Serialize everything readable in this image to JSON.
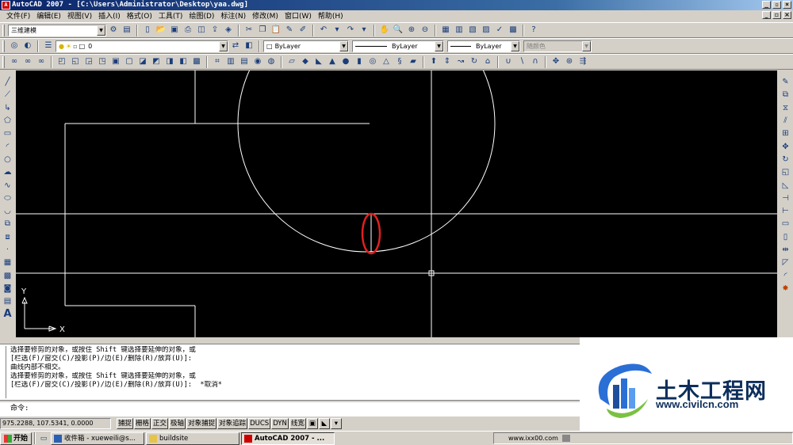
{
  "window": {
    "title": "AutoCAD 2007 - [C:\\Users\\Administrator\\Desktop\\yaa.dwg]",
    "app_icon_label": "A"
  },
  "menubar": {
    "items": [
      "文件(F)",
      "编辑(E)",
      "视图(V)",
      "插入(I)",
      "格式(O)",
      "工具(T)",
      "绘图(D)",
      "标注(N)",
      "修改(M)",
      "窗口(W)",
      "帮助(H)"
    ]
  },
  "toolbar_workspace": {
    "workspace_value": "三维建模"
  },
  "toolbar_layers": {
    "layer_value": "0"
  },
  "toolbar_properties": {
    "color_value": "ByLayer",
    "linetype_value": "ByLayer",
    "lineweight_value": "ByLayer",
    "plotstyle_value": "随颜色"
  },
  "ucs": {
    "x_label": "X",
    "y_label": "Y"
  },
  "colors": {
    "canvas_bg": "#000000",
    "geometry": "#ffffff",
    "highlight_ellipse": "#e02020"
  },
  "command_line": {
    "history": [
      "选择要修剪的对象，或按住 Shift 键选择要延伸的对象，或",
      "[栏选(F)/窗交(C)/投影(P)/边(E)/删除(R)/放弃(U)]:",
      "曲线内部不相交。",
      "选择要修剪的对象，或按住 Shift 键选择要延伸的对象，或",
      "[栏选(F)/窗交(C)/投影(P)/边(E)/删除(R)/放弃(U)]:  *取消*"
    ],
    "prompt": "命令:"
  },
  "statusbar": {
    "coordinates": "975.2288, 107.5341, 0.0000",
    "toggles": [
      "捕捉",
      "栅格",
      "正交",
      "极轴",
      "对象捕捉",
      "对象追踪",
      "DUCS",
      "DYN",
      "线宽"
    ]
  },
  "taskbar": {
    "start_label": "开始",
    "tasks": [
      {
        "label": "收件箱 - xueweili@s...",
        "icon": "mail-icon"
      },
      {
        "label": "buildsite",
        "icon": "folder-icon"
      },
      {
        "label": "AutoCAD 2007 - ...",
        "icon": "autocad-icon",
        "active": true
      }
    ],
    "tray_text": "www.ixx00.com"
  },
  "watermark": {
    "name": "土木工程网",
    "url": "www.civilcn.com"
  }
}
